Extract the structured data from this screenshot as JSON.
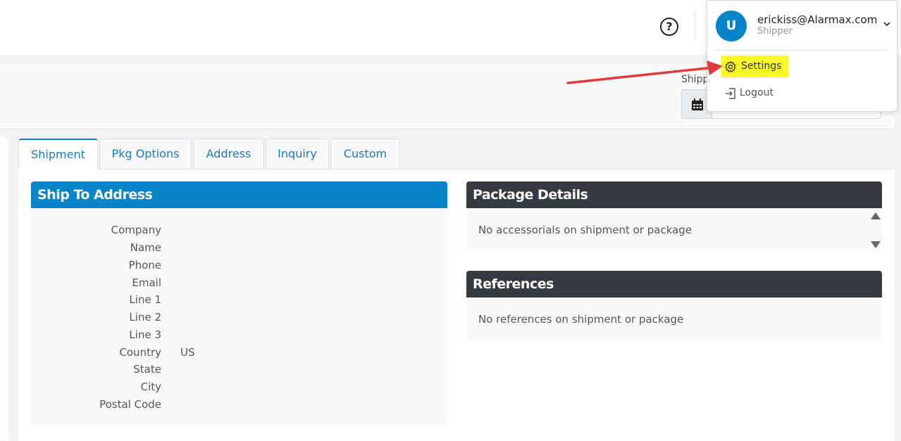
{
  "header": {
    "help_icon": "question-circle-icon"
  },
  "ship_date": {
    "label": "Shipp",
    "calendar_icon": "calendar-icon",
    "value": ""
  },
  "tabs": [
    {
      "label": "Shipment",
      "active": true
    },
    {
      "label": "Pkg Options",
      "active": false
    },
    {
      "label": "Address",
      "active": false
    },
    {
      "label": "Inquiry",
      "active": false
    },
    {
      "label": "Custom",
      "active": false
    }
  ],
  "ship_to": {
    "title": "Ship To Address",
    "fields": [
      {
        "label": "Company",
        "value": ""
      },
      {
        "label": "Name",
        "value": ""
      },
      {
        "label": "Phone",
        "value": ""
      },
      {
        "label": "Email",
        "value": ""
      },
      {
        "label": "Line 1",
        "value": ""
      },
      {
        "label": "Line 2",
        "value": ""
      },
      {
        "label": "Line 3",
        "value": ""
      },
      {
        "label": "Country",
        "value": "US"
      },
      {
        "label": "State",
        "value": ""
      },
      {
        "label": "City",
        "value": ""
      },
      {
        "label": "Postal Code",
        "value": ""
      }
    ]
  },
  "package_details": {
    "title": "Package Details",
    "empty_text": "No accessorials on shipment or package"
  },
  "references": {
    "title": "References",
    "empty_text": "No references on shipment or package"
  },
  "user_menu": {
    "avatar_initial": "U",
    "email": "erickiss@Alarmax.com",
    "role": "Shipper",
    "items": [
      {
        "label": "Settings",
        "icon": "gear-icon",
        "highlighted": true
      },
      {
        "label": "Logout",
        "icon": "logout-icon",
        "highlighted": false
      }
    ]
  },
  "colors": {
    "primary": "#0884c8",
    "dark_header": "#363a41",
    "highlight": "#f9f928",
    "annotation_arrow": "#e03b3b"
  }
}
